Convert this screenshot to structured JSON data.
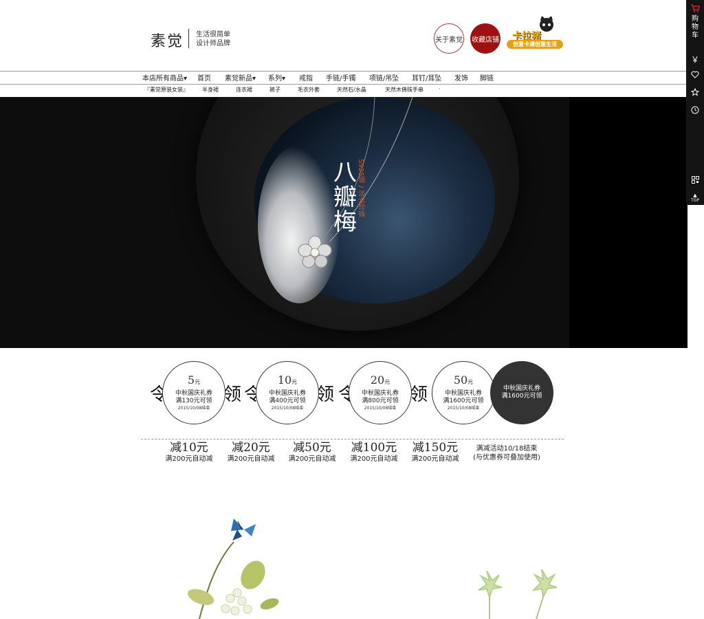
{
  "header": {
    "brand": "素觉",
    "slogan_line1": "生活很简单",
    "slogan_line2": "设计师品牌",
    "about_label": "关于素觉",
    "favorite_label": "收藏店铺",
    "partner_title": "卡拉猪",
    "partner_tagline": "创意卡通创意生活"
  },
  "nav": {
    "items": [
      {
        "label": "本店所有商品▾"
      },
      {
        "label": "首页"
      },
      {
        "label": "素觉新品▾"
      },
      {
        "label": "系列▾"
      },
      {
        "label": "戒指"
      },
      {
        "label": "手链/手镯"
      },
      {
        "label": "项链/吊坠"
      },
      {
        "label": "耳钉/耳坠"
      },
      {
        "label": "发饰"
      },
      {
        "label": "脚链"
      }
    ],
    "subitems": [
      {
        "label": "『素觉原装女装』"
      },
      {
        "label": "半身裙"
      },
      {
        "label": "连衣裙"
      },
      {
        "label": "裤子"
      },
      {
        "label": "毛衣外套"
      },
      {
        "label": "天然石/水晶"
      },
      {
        "label": "天然木佛珠手串"
      },
      {
        "label": "·"
      }
    ]
  },
  "banner": {
    "title_chars": [
      "八",
      "瓣",
      "梅"
    ],
    "subtitle": "S925银 / 淡水珍珠"
  },
  "coupons": {
    "ling_char": "令",
    "ling_tail": "领",
    "items": [
      {
        "amount": "5",
        "unit": "元",
        "name": "中秋国庆礼券",
        "condition": "满130元可领",
        "end": "2015/10/08结束"
      },
      {
        "amount": "10",
        "unit": "元",
        "name": "中秋国庆礼券",
        "condition": "满400元可领",
        "end": "2015/10/08结束"
      },
      {
        "amount": "20",
        "unit": "元",
        "name": "中秋国庆礼券",
        "condition": "满800元可领",
        "end": "2015/10/08结束"
      },
      {
        "amount": "50",
        "unit": "元",
        "name": "中秋国庆礼券",
        "condition": "满1600元可领",
        "end": "2015/10/08结束"
      }
    ],
    "dark": {
      "name": "中秋国庆礼券",
      "condition": "满1600元可领"
    }
  },
  "discounts": {
    "items": [
      {
        "big": "减10元",
        "small": "满200元自动减"
      },
      {
        "big": "减20元",
        "small": "满200元自动减"
      },
      {
        "big": "减50元",
        "small": "满200元自动减"
      },
      {
        "big": "减100元",
        "small": "满200元自动减"
      },
      {
        "big": "减150元",
        "small": "满200元自动减"
      }
    ],
    "note_line1": "满减活动10/18结束",
    "note_line2": "(与优惠券可叠加使用)"
  },
  "sidebar": {
    "cart_label": "购物车",
    "yen": "￥",
    "top_label": "TOP"
  },
  "colors": {
    "accent_red": "#9e1111",
    "banner_bg": "#0d0d0d",
    "dark_coupon": "#333333"
  },
  "icons": [
    "cart-icon",
    "yen-icon",
    "heart-icon",
    "star-icon",
    "history-icon",
    "qrcode-icon",
    "top-icon",
    "butterfly-icon"
  ]
}
